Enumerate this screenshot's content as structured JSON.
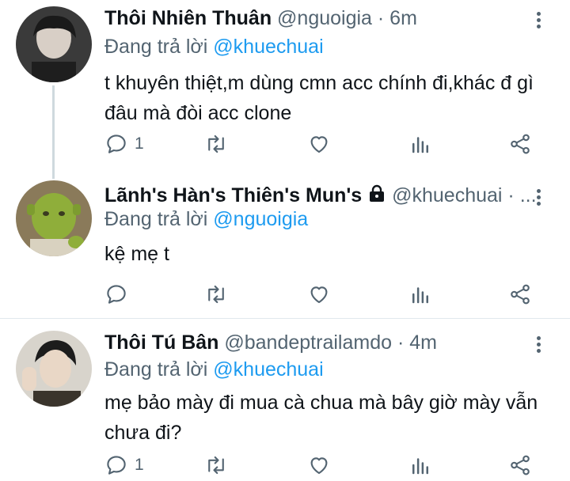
{
  "tweets": [
    {
      "name": "Thôi Nhiên Thuân",
      "meta": "@nguoigia · 6m",
      "reply_prefix": "Đang trả lời ",
      "reply_to": "@khuechuai",
      "text": "t khuyên thiệt,m dùng cmn acc chính đi,khác đ gì đâu mà đòi acc clone",
      "reply_count": "1"
    },
    {
      "name": "Lãnh's Hàn's Thiên's Mun's",
      "meta": "@khuechuai · ...",
      "reply_prefix": "Đang trả lời ",
      "reply_to": "@nguoigia",
      "text": "kệ mẹ t",
      "reply_count": ""
    },
    {
      "name": "Thôi Tú Bân",
      "meta": "@bandeptrailamdo · 4m",
      "reply_prefix": "Đang trả lời ",
      "reply_to": "@khuechuai",
      "text": "mẹ bảo mày đi mua cà chua mà bây giờ mày vẫn chưa đi?",
      "reply_count": "1"
    }
  ],
  "colors": {
    "accent": "#1d9bf0",
    "muted": "#536471",
    "divider": "#e1e8ed",
    "thread": "#cfd9de"
  },
  "icons": [
    "reply-icon",
    "retweet-icon",
    "like-icon",
    "analytics-icon",
    "share-icon",
    "more-icon",
    "lock-icon"
  ]
}
